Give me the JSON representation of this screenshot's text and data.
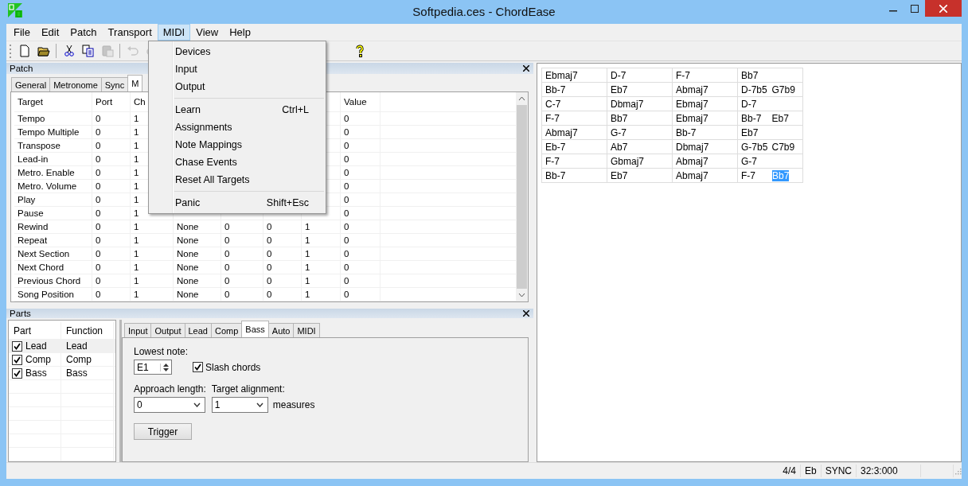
{
  "window": {
    "title": "Softpedia.ces - ChordEase"
  },
  "menu_bar": [
    {
      "label": "File",
      "selected": false
    },
    {
      "label": "Edit",
      "selected": false
    },
    {
      "label": "Patch",
      "selected": false
    },
    {
      "label": "Transport",
      "selected": false
    },
    {
      "label": "MIDI",
      "selected": true
    },
    {
      "label": "View",
      "selected": false
    },
    {
      "label": "Help",
      "selected": false
    }
  ],
  "toolbar": [
    {
      "kind": "new",
      "disabled": false
    },
    {
      "kind": "open",
      "disabled": false
    },
    {
      "kind": "separator"
    },
    {
      "kind": "cut",
      "disabled": false
    },
    {
      "kind": "copy",
      "disabled": false
    },
    {
      "kind": "paste",
      "disabled": true
    },
    {
      "kind": "separator"
    },
    {
      "kind": "undo",
      "disabled": true
    },
    {
      "kind": "redo",
      "disabled": true
    },
    {
      "kind": "gap"
    },
    {
      "kind": "help",
      "disabled": false
    }
  ],
  "midi_menu": [
    {
      "kind": "item",
      "label": "Devices"
    },
    {
      "kind": "item",
      "label": "Input"
    },
    {
      "kind": "item",
      "label": "Output"
    },
    {
      "kind": "separator"
    },
    {
      "kind": "item",
      "label": "Learn",
      "shortcut": "Ctrl+L"
    },
    {
      "kind": "item",
      "label": "Assignments"
    },
    {
      "kind": "item",
      "label": "Note Mappings"
    },
    {
      "kind": "item",
      "label": "Chase Events"
    },
    {
      "kind": "item",
      "label": "Reset All Targets"
    },
    {
      "kind": "separator"
    },
    {
      "kind": "item",
      "label": "Panic",
      "shortcut": "Shift+Esc"
    }
  ],
  "patch_panel": {
    "title": "Patch",
    "tabs": [
      {
        "label": "General",
        "selected": false
      },
      {
        "label": "Metronome",
        "selected": false
      },
      {
        "label": "Sync",
        "selected": false
      },
      {
        "label": "M",
        "selected": true
      }
    ],
    "columns": [
      "Target",
      "Port",
      "Ch",
      null,
      null,
      null,
      null,
      "Value"
    ],
    "rows": [
      [
        "Tempo",
        "0",
        "1",
        null,
        null,
        null,
        null,
        "0"
      ],
      [
        "Tempo Multiple",
        "0",
        "1",
        null,
        null,
        null,
        null,
        "0"
      ],
      [
        "Transpose",
        "0",
        "1",
        null,
        null,
        null,
        null,
        "0"
      ],
      [
        "Lead-in",
        "0",
        "1",
        null,
        null,
        null,
        null,
        "0"
      ],
      [
        "Metro. Enable",
        "0",
        "1",
        null,
        null,
        null,
        null,
        "0"
      ],
      [
        "Metro. Volume",
        "0",
        "1",
        null,
        null,
        null,
        null,
        "0"
      ],
      [
        "Play",
        "0",
        "1",
        null,
        null,
        null,
        null,
        "0"
      ],
      [
        "Pause",
        "0",
        "1",
        null,
        null,
        null,
        null,
        "0"
      ],
      [
        "Rewind",
        "0",
        "1",
        "None",
        "0",
        "0",
        "1",
        "0"
      ],
      [
        "Repeat",
        "0",
        "1",
        "None",
        "0",
        "0",
        "1",
        "0"
      ],
      [
        "Next Section",
        "0",
        "1",
        "None",
        "0",
        "0",
        "1",
        "0"
      ],
      [
        "Next Chord",
        "0",
        "1",
        "None",
        "0",
        "0",
        "1",
        "0"
      ],
      [
        "Previous Chord",
        "0",
        "1",
        "None",
        "0",
        "0",
        "1",
        "0"
      ],
      [
        "Song Position",
        "0",
        "1",
        "None",
        "0",
        "0",
        "1",
        "0"
      ]
    ]
  },
  "parts_panel": {
    "title": "Parts",
    "columns": [
      "Part",
      "Function"
    ],
    "rows": [
      {
        "part": "Lead",
        "function": "Lead",
        "checked": true,
        "selected": true
      },
      {
        "part": "Comp",
        "function": "Comp",
        "checked": true,
        "selected": false
      },
      {
        "part": "Bass",
        "function": "Bass",
        "checked": true,
        "selected": false
      }
    ],
    "tabs": [
      {
        "label": "Input",
        "selected": false
      },
      {
        "label": "Output",
        "selected": false
      },
      {
        "label": "Lead",
        "selected": false
      },
      {
        "label": "Comp",
        "selected": false
      },
      {
        "label": "Bass",
        "selected": true
      },
      {
        "label": "Auto",
        "selected": false
      },
      {
        "label": "MIDI",
        "selected": false
      }
    ],
    "lowest_note": {
      "label": "Lowest note:",
      "value": "E1"
    },
    "slash_chords": {
      "label": "Slash chords",
      "checked": true
    },
    "approach_length": {
      "label": "Approach length:",
      "value": "0"
    },
    "target_alignment": {
      "label": "Target alignment:",
      "value": "1",
      "unit": "measures"
    },
    "trigger_button": "Trigger"
  },
  "chord_chart": [
    [
      [
        {
          "name": "Ebmaj7",
          "selected": false
        }
      ],
      [
        {
          "name": "D-7",
          "selected": false
        }
      ],
      [
        {
          "name": "F-7",
          "selected": false
        }
      ],
      [
        {
          "name": "Bb7",
          "selected": false
        }
      ]
    ],
    [
      [
        {
          "name": "Bb-7",
          "selected": false
        }
      ],
      [
        {
          "name": "Eb7",
          "selected": false
        }
      ],
      [
        {
          "name": "Abmaj7",
          "selected": false
        }
      ],
      [
        {
          "name": "D-7b5",
          "selected": false
        },
        {
          "name": "G7b9",
          "selected": false
        }
      ]
    ],
    [
      [
        {
          "name": "C-7",
          "selected": false
        }
      ],
      [
        {
          "name": "Dbmaj7",
          "selected": false
        }
      ],
      [
        {
          "name": "Ebmaj7",
          "selected": false
        }
      ],
      [
        {
          "name": "D-7",
          "selected": false
        }
      ]
    ],
    [
      [
        {
          "name": "F-7",
          "selected": false
        }
      ],
      [
        {
          "name": "Bb7",
          "selected": false
        }
      ],
      [
        {
          "name": "Ebmaj7",
          "selected": false
        }
      ],
      [
        {
          "name": "Bb-7",
          "selected": false
        },
        {
          "name": "Eb7",
          "selected": false
        }
      ]
    ],
    [
      [
        {
          "name": "Abmaj7",
          "selected": false
        }
      ],
      [
        {
          "name": "G-7",
          "selected": false
        }
      ],
      [
        {
          "name": "Bb-7",
          "selected": false
        }
      ],
      [
        {
          "name": "Eb7",
          "selected": false
        }
      ]
    ],
    [
      [
        {
          "name": "Eb-7",
          "selected": false
        }
      ],
      [
        {
          "name": "Ab7",
          "selected": false
        }
      ],
      [
        {
          "name": "Dbmaj7",
          "selected": false
        }
      ],
      [
        {
          "name": "G-7b5",
          "selected": false
        },
        {
          "name": "C7b9",
          "selected": false
        }
      ]
    ],
    [
      [
        {
          "name": "F-7",
          "selected": false
        }
      ],
      [
        {
          "name": "Gbmaj7",
          "selected": false
        }
      ],
      [
        {
          "name": "Abmaj7",
          "selected": false
        }
      ],
      [
        {
          "name": "G-7",
          "selected": false
        }
      ]
    ],
    [
      [
        {
          "name": "Bb-7",
          "selected": false
        }
      ],
      [
        {
          "name": "Eb7",
          "selected": false
        }
      ],
      [
        {
          "name": "Abmaj7",
          "selected": false
        }
      ],
      [
        {
          "name": "F-7",
          "selected": false
        },
        {
          "name": "Bb7",
          "selected": true
        }
      ]
    ]
  ],
  "status_bar": [
    "4/4",
    "Eb",
    "SYNC",
    "32:3:000"
  ]
}
